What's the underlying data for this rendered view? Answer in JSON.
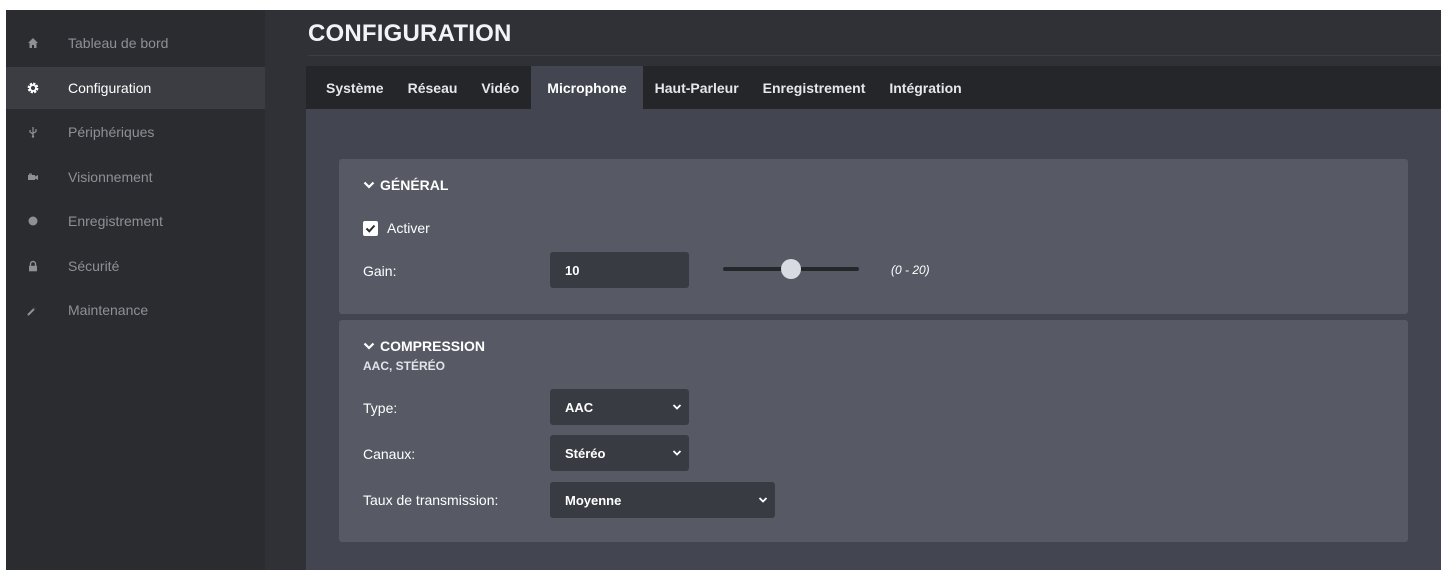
{
  "sidebar": {
    "items": [
      {
        "label": "Tableau de bord",
        "icon": "home-icon",
        "active": false
      },
      {
        "label": "Configuration",
        "icon": "gear-icon",
        "active": true
      },
      {
        "label": "Périphériques",
        "icon": "usb-icon",
        "active": false
      },
      {
        "label": "Visionnement",
        "icon": "camera-icon",
        "active": false
      },
      {
        "label": "Enregistrement",
        "icon": "record-icon",
        "active": false
      },
      {
        "label": "Sécurité",
        "icon": "lock-icon",
        "active": false
      },
      {
        "label": "Maintenance",
        "icon": "wrench-icon",
        "active": false
      }
    ]
  },
  "header": {
    "title": "CONFIGURATION"
  },
  "tabs": [
    {
      "label": "Système"
    },
    {
      "label": "Réseau"
    },
    {
      "label": "Vidéo"
    },
    {
      "label": "Microphone",
      "active": true
    },
    {
      "label": "Haut-Parleur"
    },
    {
      "label": "Enregistrement"
    },
    {
      "label": "Intégration"
    }
  ],
  "general": {
    "title": "GÉNÉRAL",
    "enable_label": "Activer",
    "enabled": true,
    "gain_label": "Gain:",
    "gain_value": "10",
    "gain_range": "(0 - 20)",
    "gain_min": 0,
    "gain_max": 20
  },
  "compression": {
    "title": "COMPRESSION",
    "subtitle": "AAC, STÉRÉO",
    "type_label": "Type:",
    "type_value": "AAC",
    "channels_label": "Canaux:",
    "channels_value": "Stéréo",
    "bitrate_label": "Taux de transmission:",
    "bitrate_value": "Moyenne"
  },
  "colors": {
    "sidebar_bg": "#2b2c30",
    "sidebar_active_bg": "#3c3d43",
    "tabbar_bg": "#25262a",
    "content_bg": "#434650",
    "panel_bg": "#575a65",
    "field_bg": "#393b42"
  }
}
